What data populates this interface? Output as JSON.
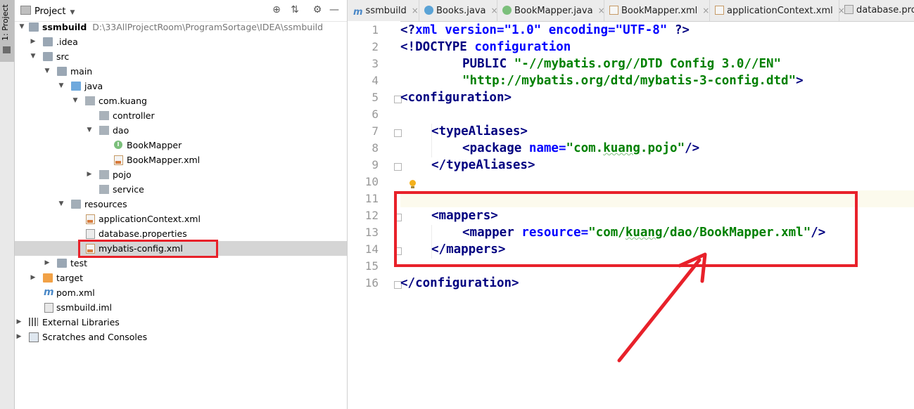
{
  "tool_strip": {
    "label": "1: Project"
  },
  "project_panel": {
    "title": "Project",
    "tree": [
      {
        "name": "ssmbuild",
        "path": "D:\\33AllProjectRoom\\ProgramSortage\\IDEA\\ssmbuild",
        "icon": "module-folder-icon"
      },
      {
        "name": ".idea",
        "icon": "folder-icon"
      },
      {
        "name": "src",
        "icon": "folder-icon"
      },
      {
        "name": "main",
        "icon": "folder-icon"
      },
      {
        "name": "java",
        "icon": "source-folder-icon"
      },
      {
        "name": "com.kuang",
        "icon": "package-icon"
      },
      {
        "name": "controller",
        "icon": "package-icon"
      },
      {
        "name": "dao",
        "icon": "package-icon"
      },
      {
        "name": "BookMapper",
        "icon": "interface-icon"
      },
      {
        "name": "BookMapper.xml",
        "icon": "xml-file-icon"
      },
      {
        "name": "pojo",
        "icon": "package-icon"
      },
      {
        "name": "service",
        "icon": "package-icon"
      },
      {
        "name": "resources",
        "icon": "resources-folder-icon"
      },
      {
        "name": "applicationContext.xml",
        "icon": "spring-xml-icon"
      },
      {
        "name": "database.properties",
        "icon": "properties-file-icon"
      },
      {
        "name": "mybatis-config.xml",
        "icon": "xml-file-icon",
        "selected": true
      },
      {
        "name": "test",
        "icon": "folder-icon"
      },
      {
        "name": "target",
        "icon": "excluded-folder-icon"
      },
      {
        "name": "pom.xml",
        "icon": "maven-icon"
      },
      {
        "name": "ssmbuild.iml",
        "icon": "iml-file-icon"
      },
      {
        "name": "External Libraries",
        "icon": "libraries-icon"
      },
      {
        "name": "Scratches and Consoles",
        "icon": "scratches-icon"
      }
    ]
  },
  "editor": {
    "tabs": [
      {
        "label": "ssmbuild",
        "icon": "maven-icon"
      },
      {
        "label": "Books.java",
        "icon": "class-icon"
      },
      {
        "label": "BookMapper.java",
        "icon": "interface-icon"
      },
      {
        "label": "BookMapper.xml",
        "icon": "xml-file-icon"
      },
      {
        "label": "applicationContext.xml",
        "icon": "spring-xml-icon"
      },
      {
        "label": "database.prope",
        "icon": "properties-file-icon"
      }
    ],
    "close_glyph": "×",
    "line_numbers": [
      "1",
      "2",
      "3",
      "4",
      "5",
      "6",
      "7",
      "8",
      "9",
      "10",
      "11",
      "12",
      "13",
      "14",
      "15",
      "16"
    ],
    "code": {
      "l1": {
        "a": "<?",
        "b": "xml version=\"1.0\" encoding=\"UTF-8\"",
        "c": " ?>"
      },
      "l2": {
        "a": "<!DOCTYPE ",
        "b": "configuration"
      },
      "l3": {
        "a": "PUBLIC ",
        "b": "\"-//mybatis.org//DTD Config 3.0//EN\""
      },
      "l4": {
        "a": "\"http://mybatis.org/dtd/mybatis-3-config.dtd\"",
        "b": ">"
      },
      "l5": {
        "a": "<configuration>"
      },
      "l7": {
        "a": "<typeAliases>"
      },
      "l8": {
        "a": "<package ",
        "b": "name",
        "c": "=",
        "d": "\"com.",
        "e": "kuang",
        "f": ".pojo\"",
        "g": "/>"
      },
      "l9": {
        "a": "</typeAliases>"
      },
      "l12": {
        "a": "<mappers>"
      },
      "l13": {
        "a": "<mapper ",
        "b": "resource",
        "c": "=",
        "d": "\"com/",
        "e": "kuang",
        "f": "/dao/BookMapper.xml\"",
        "g": "/>"
      },
      "l14": {
        "a": "</mappers>"
      },
      "l16": {
        "a": "</configuration>"
      }
    }
  },
  "colors": {
    "annotation_red": "#e8212a",
    "tag": "#000080",
    "attr": "#0000ff",
    "string": "#008000"
  }
}
